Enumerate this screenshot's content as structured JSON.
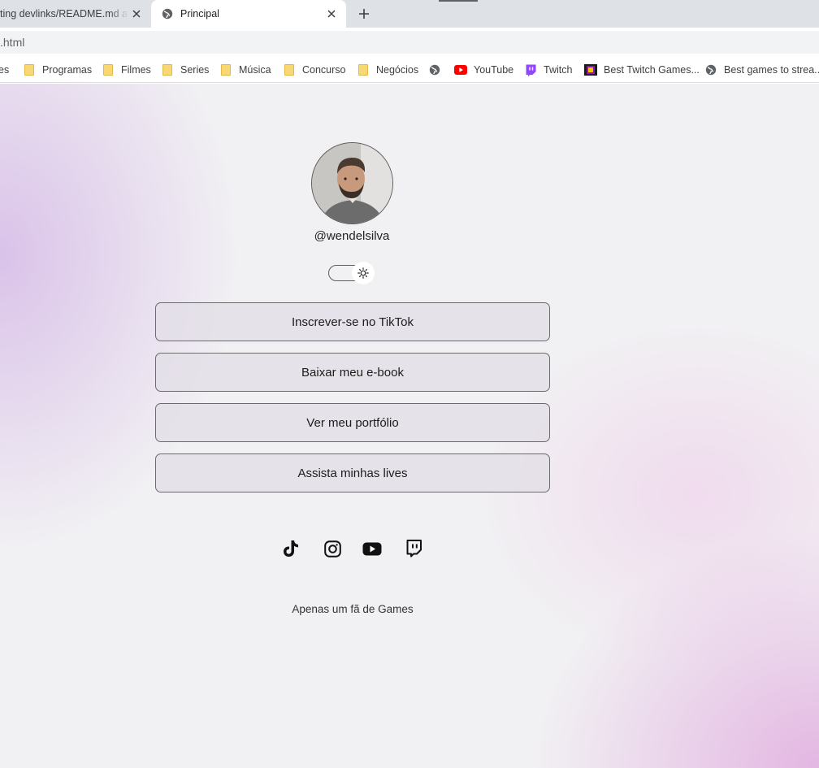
{
  "browser": {
    "tabs": [
      {
        "title": "ting devlinks/README.md at m",
        "active": false
      },
      {
        "title": "Principal",
        "active": true
      }
    ],
    "url": ".html",
    "bookmarks": [
      {
        "label": "es",
        "icon": "folder-icon"
      },
      {
        "label": "Programas",
        "icon": "folder-icon"
      },
      {
        "label": "Filmes",
        "icon": "folder-icon"
      },
      {
        "label": "Series",
        "icon": "folder-icon"
      },
      {
        "label": "Música",
        "icon": "folder-icon"
      },
      {
        "label": "Concurso",
        "icon": "folder-icon"
      },
      {
        "label": "Negócios",
        "icon": "folder-icon"
      },
      {
        "label": "",
        "icon": "globe-icon"
      },
      {
        "label": "YouTube",
        "icon": "youtube-icon"
      },
      {
        "label": "Twitch",
        "icon": "twitch-icon"
      },
      {
        "label": "Best Twitch Games...",
        "icon": "site-favicon-icon"
      },
      {
        "label": "Best games to strea...",
        "icon": "globe-icon"
      }
    ]
  },
  "profile": {
    "username": "@wendelsilva",
    "theme_toggle_icon": "sun-icon"
  },
  "links": [
    {
      "label": "Inscrever-se no TikTok"
    },
    {
      "label": "Baixar meu e-book"
    },
    {
      "label": "Ver meu portfólio"
    },
    {
      "label": "Assista minhas lives"
    }
  ],
  "social": [
    "tiktok-icon",
    "instagram-icon",
    "youtube-icon",
    "twitch-icon"
  ],
  "footer": {
    "text": "Apenas um fã de Games"
  },
  "colors": {
    "youtube": "#ff0000",
    "twitch": "#9146ff",
    "folder": "#f8d775"
  }
}
